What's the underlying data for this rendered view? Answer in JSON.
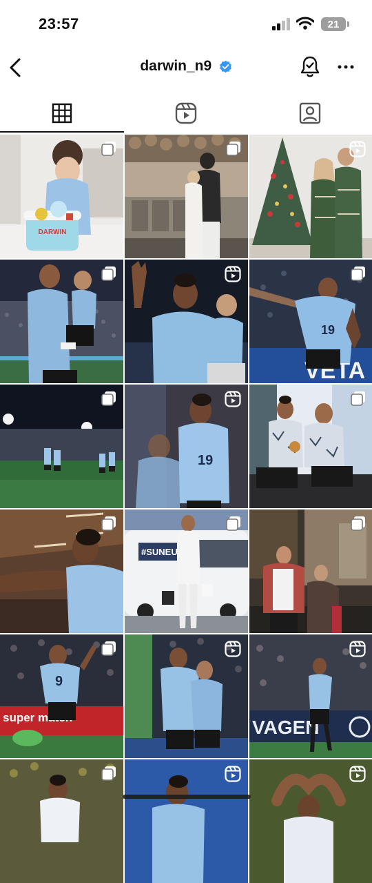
{
  "status_bar": {
    "time": "23:57",
    "battery": "21"
  },
  "header": {
    "username": "darwin_n9",
    "verified": true
  },
  "tabs": [
    {
      "name": "posts-grid",
      "icon": "grid-icon",
      "active": true
    },
    {
      "name": "reels",
      "icon": "reels-icon",
      "active": false
    },
    {
      "name": "tagged",
      "icon": "tagged-user-icon",
      "active": false
    }
  ],
  "posts": [
    {
      "type": "carousel",
      "scene": "birthday-cake",
      "cake_text": "DARWIN"
    },
    {
      "type": "carousel",
      "scene": "party-balloons"
    },
    {
      "type": "reel",
      "scene": "christmas-tree"
    },
    {
      "type": "carousel",
      "scene": "stadium-holding-child"
    },
    {
      "type": "reel",
      "scene": "child-wave"
    },
    {
      "type": "carousel",
      "scene": "celebration",
      "shirt_number": "19",
      "banner_text": "VETA"
    },
    {
      "type": "carousel",
      "scene": "stadium-night"
    },
    {
      "type": "reel",
      "scene": "closeup",
      "shirt_number": "19"
    },
    {
      "type": "carousel",
      "scene": "teammates-sitting"
    },
    {
      "type": "carousel",
      "scene": "profile-stadium"
    },
    {
      "type": "carousel",
      "scene": "bus-arrival",
      "bus_text": "#SUNEU"
    },
    {
      "type": "carousel",
      "scene": "fans-meet"
    },
    {
      "type": "carousel",
      "scene": "match-number-9",
      "shirt_number": "9",
      "board_text": "super match"
    },
    {
      "type": "reel",
      "scene": "goal-celebration"
    },
    {
      "type": "reel",
      "scene": "kick",
      "board_text": "VAGEN"
    },
    {
      "type": "carousel",
      "scene": "hug"
    },
    {
      "type": "reel",
      "scene": "back-view"
    },
    {
      "type": "reel",
      "scene": "heart-hands"
    }
  ]
}
